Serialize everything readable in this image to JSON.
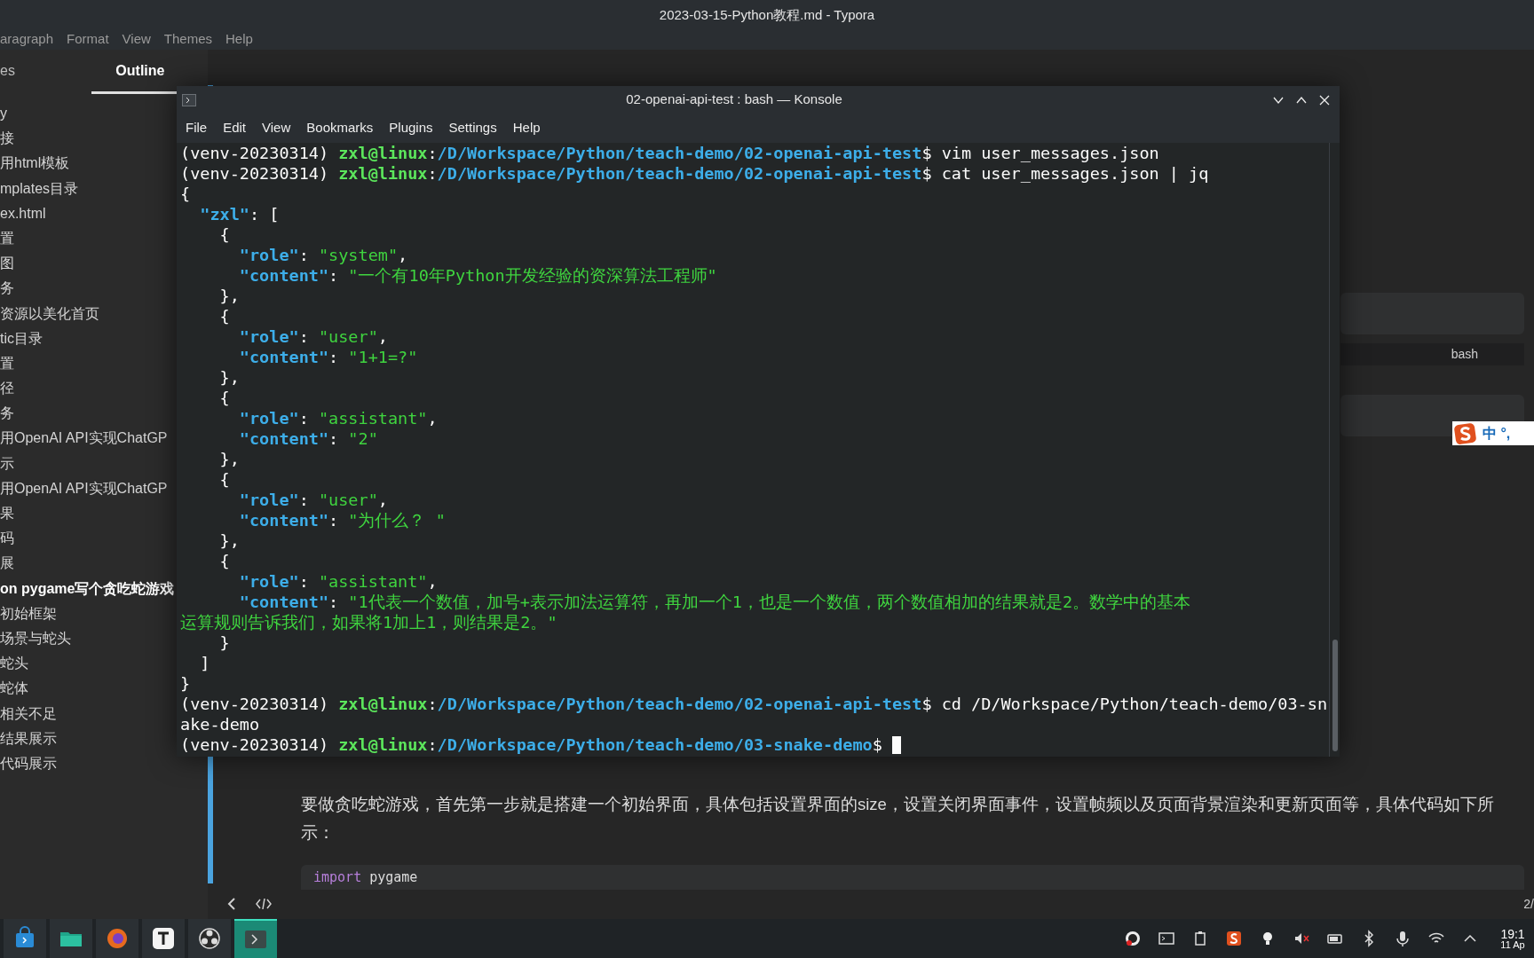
{
  "window": {
    "title": "2023-03-15-Python教程.md - Typora"
  },
  "menu": [
    "aragraph",
    "Format",
    "View",
    "Themes",
    "Help"
  ],
  "sidebar": {
    "tabs": [
      {
        "label": "es",
        "selected": false
      },
      {
        "label": "Outline",
        "selected": true
      }
    ],
    "items": [
      {
        "text": "y",
        "bold": false
      },
      {
        "text": "接",
        "bold": false
      },
      {
        "text": "用html模板",
        "bold": false
      },
      {
        "text": "mplates目录",
        "bold": false
      },
      {
        "text": "ex.html",
        "bold": false
      },
      {
        "text": "置",
        "bold": false
      },
      {
        "text": "图",
        "bold": false
      },
      {
        "text": "务",
        "bold": false
      },
      {
        "text": "资源以美化首页",
        "bold": false
      },
      {
        "text": "tic目录",
        "bold": false
      },
      {
        "text": "置",
        "bold": false
      },
      {
        "text": "径",
        "bold": false
      },
      {
        "text": "务",
        "bold": false
      },
      {
        "text": "用OpenAI API实现ChatGP",
        "bold": false
      },
      {
        "text": "示",
        "bold": false
      },
      {
        "text": "用OpenAI API实现ChatGP",
        "bold": false
      },
      {
        "text": "果",
        "bold": false
      },
      {
        "text": "码",
        "bold": false
      },
      {
        "text": "展",
        "bold": false
      },
      {
        "text": "on pygame写个贪吃蛇游戏",
        "bold": true
      },
      {
        "text": "初始框架",
        "bold": false
      },
      {
        "text": "场景与蛇头",
        "bold": false
      },
      {
        "text": "蛇头",
        "bold": false
      },
      {
        "text": "蛇体",
        "bold": false
      },
      {
        "text": "相关不足",
        "bold": false
      },
      {
        "text": "结果展示",
        "bold": false
      },
      {
        "text": "代码展示",
        "bold": false
      }
    ]
  },
  "konsole": {
    "title": "02-openai-api-test : bash — Konsole",
    "menu": [
      "File",
      "Edit",
      "View",
      "Bookmarks",
      "Plugins",
      "Settings",
      "Help"
    ],
    "lines": [
      [
        {
          "kind": "p",
          "text": "(venv-20230314) "
        },
        {
          "kind": "u",
          "text": "zxl@linux"
        },
        {
          "kind": "p",
          "text": ":"
        },
        {
          "kind": "d",
          "text": "/D/Workspace/Python/teach-demo/02-openai-api-test"
        },
        {
          "kind": "p",
          "text": "$ vim user_messages.json"
        }
      ],
      [
        {
          "kind": "p",
          "text": "(venv-20230314) "
        },
        {
          "kind": "u",
          "text": "zxl@linux"
        },
        {
          "kind": "p",
          "text": ":"
        },
        {
          "kind": "d",
          "text": "/D/Workspace/Python/teach-demo/02-openai-api-test"
        },
        {
          "kind": "p",
          "text": "$ cat user_messages.json | jq"
        }
      ],
      [
        {
          "kind": "p",
          "text": "{"
        }
      ],
      [
        {
          "kind": "k",
          "text": "  \"zxl\""
        },
        {
          "kind": "p",
          "text": ": ["
        }
      ],
      [
        {
          "kind": "p",
          "text": "    {"
        }
      ],
      [
        {
          "kind": "k",
          "text": "      \"role\""
        },
        {
          "kind": "p",
          "text": ": "
        },
        {
          "kind": "s",
          "text": "\"system\""
        },
        {
          "kind": "p",
          "text": ","
        }
      ],
      [
        {
          "kind": "k",
          "text": "      \"content\""
        },
        {
          "kind": "p",
          "text": ": "
        },
        {
          "kind": "s",
          "text": "\"一个有10年Python开发经验的资深算法工程师\""
        }
      ],
      [
        {
          "kind": "p",
          "text": "    },"
        }
      ],
      [
        {
          "kind": "p",
          "text": "    {"
        }
      ],
      [
        {
          "kind": "k",
          "text": "      \"role\""
        },
        {
          "kind": "p",
          "text": ": "
        },
        {
          "kind": "s",
          "text": "\"user\""
        },
        {
          "kind": "p",
          "text": ","
        }
      ],
      [
        {
          "kind": "k",
          "text": "      \"content\""
        },
        {
          "kind": "p",
          "text": ": "
        },
        {
          "kind": "s",
          "text": "\"1+1=?\""
        }
      ],
      [
        {
          "kind": "p",
          "text": "    },"
        }
      ],
      [
        {
          "kind": "p",
          "text": "    {"
        }
      ],
      [
        {
          "kind": "k",
          "text": "      \"role\""
        },
        {
          "kind": "p",
          "text": ": "
        },
        {
          "kind": "s",
          "text": "\"assistant\""
        },
        {
          "kind": "p",
          "text": ","
        }
      ],
      [
        {
          "kind": "k",
          "text": "      \"content\""
        },
        {
          "kind": "p",
          "text": ": "
        },
        {
          "kind": "s",
          "text": "\"2\""
        }
      ],
      [
        {
          "kind": "p",
          "text": "    },"
        }
      ],
      [
        {
          "kind": "p",
          "text": "    {"
        }
      ],
      [
        {
          "kind": "k",
          "text": "      \"role\""
        },
        {
          "kind": "p",
          "text": ": "
        },
        {
          "kind": "s",
          "text": "\"user\""
        },
        {
          "kind": "p",
          "text": ","
        }
      ],
      [
        {
          "kind": "k",
          "text": "      \"content\""
        },
        {
          "kind": "p",
          "text": ": "
        },
        {
          "kind": "s",
          "text": "\"为什么？ \""
        }
      ],
      [
        {
          "kind": "p",
          "text": "    },"
        }
      ],
      [
        {
          "kind": "p",
          "text": "    {"
        }
      ],
      [
        {
          "kind": "k",
          "text": "      \"role\""
        },
        {
          "kind": "p",
          "text": ": "
        },
        {
          "kind": "s",
          "text": "\"assistant\""
        },
        {
          "kind": "p",
          "text": ","
        }
      ],
      [
        {
          "kind": "k",
          "text": "      \"content\""
        },
        {
          "kind": "p",
          "text": ": "
        },
        {
          "kind": "s",
          "text": "\"1代表一个数值，加号+表示加法运算符，再加一个1，也是一个数值，两个数值相加的结果就是2。数学中的基本"
        }
      ],
      [
        {
          "kind": "s",
          "text": "运算规则告诉我们，如果将1加上1，则结果是2。\""
        }
      ],
      [
        {
          "kind": "p",
          "text": "    }"
        }
      ],
      [
        {
          "kind": "p",
          "text": "  ]"
        }
      ],
      [
        {
          "kind": "p",
          "text": "}"
        }
      ],
      [
        {
          "kind": "p",
          "text": "(venv-20230314) "
        },
        {
          "kind": "u",
          "text": "zxl@linux"
        },
        {
          "kind": "p",
          "text": ":"
        },
        {
          "kind": "d",
          "text": "/D/Workspace/Python/teach-demo/02-openai-api-test"
        },
        {
          "kind": "p",
          "text": "$ cd /D/Workspace/Python/teach-demo/03-sn"
        }
      ],
      [
        {
          "kind": "p",
          "text": "ake-demo"
        }
      ],
      [
        {
          "kind": "p",
          "text": "(venv-20230314) "
        },
        {
          "kind": "u",
          "text": "zxl@linux"
        },
        {
          "kind": "p",
          "text": ":"
        },
        {
          "kind": "d",
          "text": "/D/Workspace/Python/teach-demo/03-snake-demo"
        },
        {
          "kind": "p",
          "text": "$ "
        },
        {
          "kind": "cursor"
        }
      ]
    ]
  },
  "editor": {
    "code_label": "bash",
    "paragraph": "要做贪吃蛇游戏，首先第一步就是搭建一个初始界面，具体包括设置界面的size，设置关闭界面事件，设置帧频以及页面背景渲染和更新页面等，具体代码如下所示：",
    "code": [
      {
        "kind": "keyword",
        "text": "import"
      },
      {
        "kind": "plain",
        "text": " pygame"
      }
    ]
  },
  "ime": {
    "text": "中 °,"
  },
  "status_bar": {
    "page": "2/"
  },
  "taskbar": {
    "apps": [
      {
        "kind": "store",
        "selected": false
      },
      {
        "kind": "files",
        "selected": false
      },
      {
        "kind": "browser",
        "selected": false
      },
      {
        "kind": "typora",
        "selected": false
      },
      {
        "kind": "obs",
        "selected": false
      },
      {
        "kind": "terminal",
        "selected": true
      }
    ],
    "clock": "19:1",
    "date": "11 Ap"
  }
}
